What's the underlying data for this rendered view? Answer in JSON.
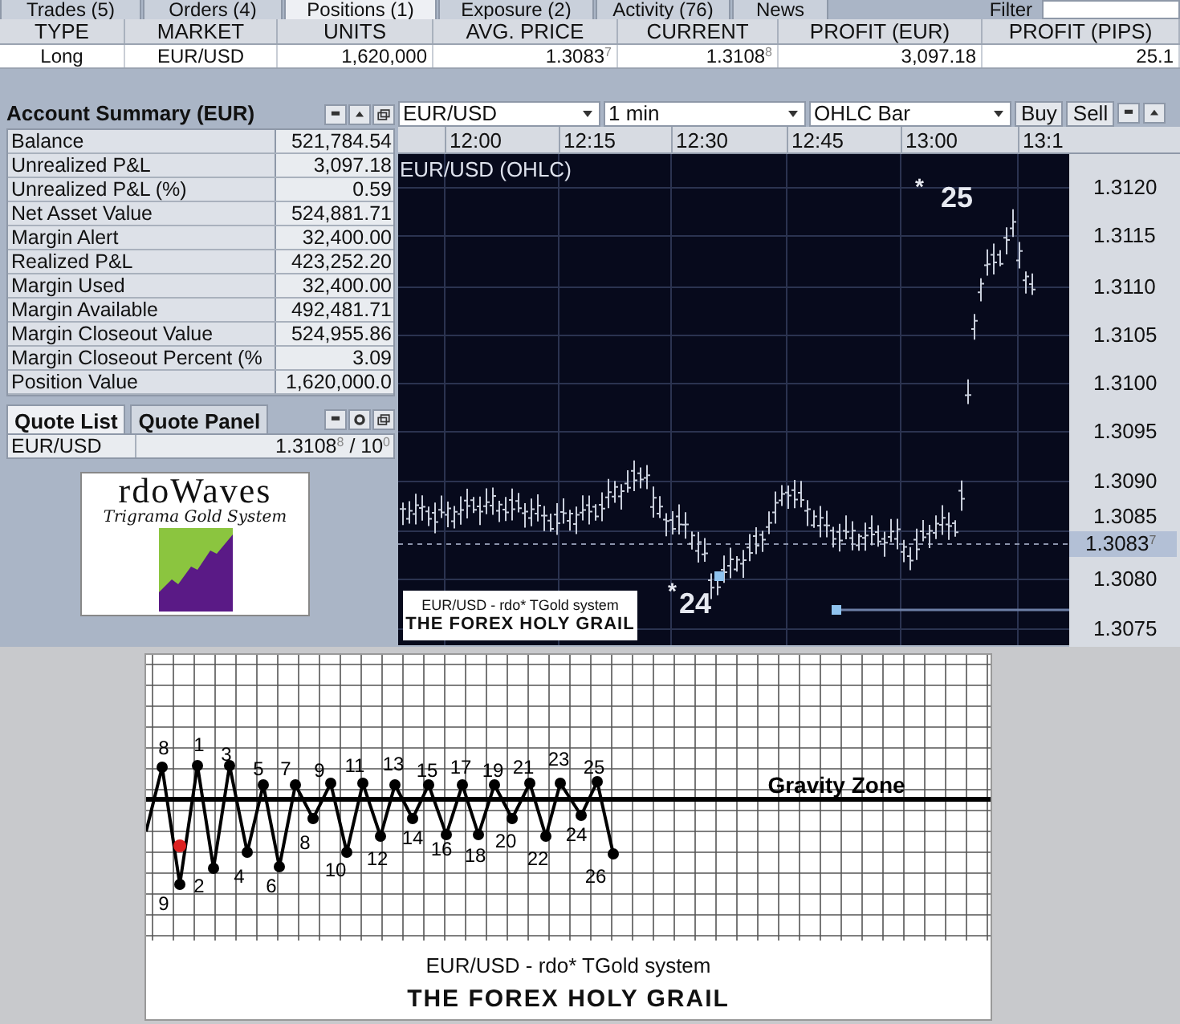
{
  "tabs": [
    {
      "label": "Trades (5)",
      "selected": false
    },
    {
      "label": "Orders (4)",
      "selected": false
    },
    {
      "label": "Positions (1)",
      "selected": true
    },
    {
      "label": "Exposure (2)",
      "selected": false
    },
    {
      "label": "Activity (76)",
      "selected": false
    },
    {
      "label": "News",
      "selected": false
    }
  ],
  "filter": {
    "label": "Filter"
  },
  "positions": {
    "columns": [
      "TYPE",
      "MARKET",
      "UNITS",
      "AVG. PRICE",
      "CURRENT",
      "PROFIT (EUR)",
      "PROFIT (PIPS)"
    ],
    "rows": [
      {
        "cells": [
          "Long",
          "EUR/USD",
          "1,620,000",
          "1.3083$^{7}$",
          "1.3108$^{8}$",
          "3,097.18",
          "25.1"
        ]
      }
    ]
  },
  "account_summary": {
    "title": "Account Summary (EUR)",
    "rows": [
      {
        "label": "Balance",
        "value": "521,784.54"
      },
      {
        "label": "Unrealized P&L",
        "value": "3,097.18"
      },
      {
        "label": "Unrealized P&L (%)",
        "value": "0.59"
      },
      {
        "label": "Net Asset Value",
        "value": "524,881.71"
      },
      {
        "label": "Margin Alert",
        "value": "32,400.00"
      },
      {
        "label": "Realized P&L",
        "value": "423,252.20"
      },
      {
        "label": "Margin Used",
        "value": "32,400.00"
      },
      {
        "label": "Margin Available",
        "value": "492,481.71"
      },
      {
        "label": "Margin Closeout Value",
        "value": "524,955.86"
      },
      {
        "label": "Margin Closeout Percent (%",
        "value": "3.09"
      },
      {
        "label": "Position Value",
        "value": "1,620,000.0"
      }
    ]
  },
  "quote_tabs": [
    {
      "label": "Quote List",
      "selected": true
    },
    {
      "label": "Quote Panel",
      "selected": false
    }
  ],
  "quotes": [
    {
      "market": "EUR/USD",
      "price": "1.3108$^{8}$ / 10$^{0}$"
    }
  ],
  "logo": {
    "title": "rdoWaves",
    "subtitle": "Trigrama Gold System"
  },
  "chart": {
    "symbol": "EUR/USD",
    "interval": "1 min",
    "type": "OHLC Bar",
    "buttons": [
      "Buy",
      "Sell"
    ],
    "time_labels": [
      "12:00",
      "12:15",
      "12:30",
      "12:45",
      "13:00",
      "13:1"
    ],
    "title": "EUR/USD (OHLC)",
    "price_labels": [
      "1.3120",
      "1.3115",
      "1.3110",
      "1.3105",
      "1.3100",
      "1.3095",
      "1.3090",
      "1.3085",
      "1.3080",
      "1.3075"
    ],
    "current_price": "1.3083$^{7}$",
    "annotations": [
      {
        "star": "*",
        "label": "25"
      },
      {
        "star": "*",
        "label": "24"
      }
    ],
    "inset": {
      "subtitle": "EUR/USD - rdo* TGold system",
      "title": "THE FOREX HOLY GRAIL"
    }
  },
  "wave_diagram": {
    "labels": [
      "8",
      "9",
      "1",
      "2",
      "3",
      "4",
      "5",
      "6",
      "7",
      "8",
      "9",
      "10",
      "11",
      "12",
      "13",
      "14",
      "15",
      "16",
      "17",
      "18",
      "19",
      "20",
      "21",
      "22",
      "23",
      "24",
      "25",
      "26"
    ],
    "zone_label": "Gravity Zone",
    "subtitle": "EUR/USD - rdo* TGold system",
    "title": "THE FOREX HOLY GRAIL"
  }
}
